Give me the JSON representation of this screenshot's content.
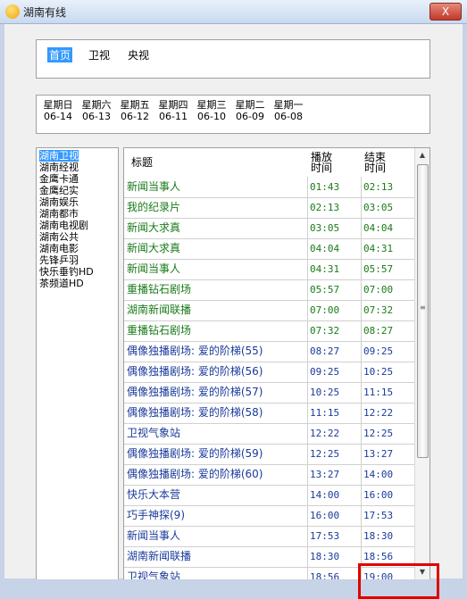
{
  "window": {
    "title": "湖南有线",
    "close_label": "X"
  },
  "tabs": [
    "首页",
    "卫视",
    "央视"
  ],
  "days": [
    {
      "name": "星期日",
      "date": "06-14"
    },
    {
      "name": "星期六",
      "date": "06-13"
    },
    {
      "name": "星期五",
      "date": "06-12"
    },
    {
      "name": "星期四",
      "date": "06-11"
    },
    {
      "name": "星期三",
      "date": "06-10"
    },
    {
      "name": "星期二",
      "date": "06-09"
    },
    {
      "name": "星期一",
      "date": "06-08"
    }
  ],
  "channels": [
    "湖南卫视",
    "湖南经视",
    "金鹰卡通",
    "金鹰纪实",
    "湖南娱乐",
    "湖南都市",
    "湖南电视剧",
    "湖南公共",
    "湖南电影",
    "先锋乒羽",
    "快乐垂钓HD",
    "茶频道HD"
  ],
  "schedule": {
    "headers": {
      "title": "标题",
      "start": "播放\n时间",
      "end": "结束\n时间"
    },
    "rows": [
      {
        "title": "新闻当事人",
        "start": "01:43",
        "end": "02:13",
        "color": "green"
      },
      {
        "title": "我的纪录片",
        "start": "02:13",
        "end": "03:05",
        "color": "green"
      },
      {
        "title": "新闻大求真",
        "start": "03:05",
        "end": "04:04",
        "color": "green"
      },
      {
        "title": "新闻大求真",
        "start": "04:04",
        "end": "04:31",
        "color": "green"
      },
      {
        "title": "新闻当事人",
        "start": "04:31",
        "end": "05:57",
        "color": "green"
      },
      {
        "title": "重播钻石剧场",
        "start": "05:57",
        "end": "07:00",
        "color": "green"
      },
      {
        "title": "湖南新闻联播",
        "start": "07:00",
        "end": "07:32",
        "color": "green"
      },
      {
        "title": "重播钻石剧场",
        "start": "07:32",
        "end": "08:27",
        "color": "green"
      },
      {
        "title": "偶像独播剧场: 爱的阶梯(55)",
        "start": "08:27",
        "end": "09:25",
        "color": "blue"
      },
      {
        "title": "偶像独播剧场: 爱的阶梯(56)",
        "start": "09:25",
        "end": "10:25",
        "color": "blue"
      },
      {
        "title": "偶像独播剧场: 爱的阶梯(57)",
        "start": "10:25",
        "end": "11:15",
        "color": "blue"
      },
      {
        "title": "偶像独播剧场: 爱的阶梯(58)",
        "start": "11:15",
        "end": "12:22",
        "color": "blue"
      },
      {
        "title": "卫视气象站",
        "start": "12:22",
        "end": "12:25",
        "color": "blue"
      },
      {
        "title": "偶像独播剧场: 爱的阶梯(59)",
        "start": "12:25",
        "end": "13:27",
        "color": "blue"
      },
      {
        "title": "偶像独播剧场: 爱的阶梯(60)",
        "start": "13:27",
        "end": "14:00",
        "color": "blue"
      },
      {
        "title": "快乐大本营",
        "start": "14:00",
        "end": "16:00",
        "color": "blue"
      },
      {
        "title": "巧手神探(9)",
        "start": "16:00",
        "end": "17:53",
        "color": "blue"
      },
      {
        "title": "新闻当事人",
        "start": "17:53",
        "end": "18:30",
        "color": "blue"
      },
      {
        "title": "湖南新闻联播",
        "start": "18:30",
        "end": "18:56",
        "color": "blue"
      },
      {
        "title": "卫视气象站",
        "start": "18:56",
        "end": "19:00",
        "color": "blue"
      }
    ]
  }
}
